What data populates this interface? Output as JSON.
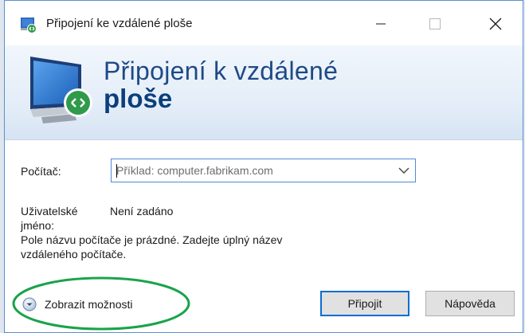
{
  "window": {
    "title": "Připojení ke vzdálené ploše"
  },
  "banner": {
    "line1": "Připojení k vzdálené",
    "line2": "ploše"
  },
  "form": {
    "computer_label": "Počítač:",
    "computer_placeholder": "Příklad: computer.fabrikam.com",
    "username_label_line1": "Uživatelské",
    "username_label_line2": "jméno:",
    "username_value": "Není zadáno",
    "message_line1": "Pole názvu počítače je prázdné. Zadejte úplný název",
    "message_line2": "vzdáleného počítače."
  },
  "footer": {
    "show_options_label": "Zobrazit možnosti",
    "connect_label": "Připojit",
    "help_label": "Nápověda"
  },
  "colors": {
    "banner_title": "#1e4a86",
    "focus_border": "#4f8bd6",
    "annotation_ellipse": "#1aa34a"
  },
  "icons": {
    "title": "remote-desktop-icon",
    "banner": "remote-desktop-monitor-icon",
    "combo": "chevron-down-icon",
    "options": "expand-circle-icon"
  }
}
